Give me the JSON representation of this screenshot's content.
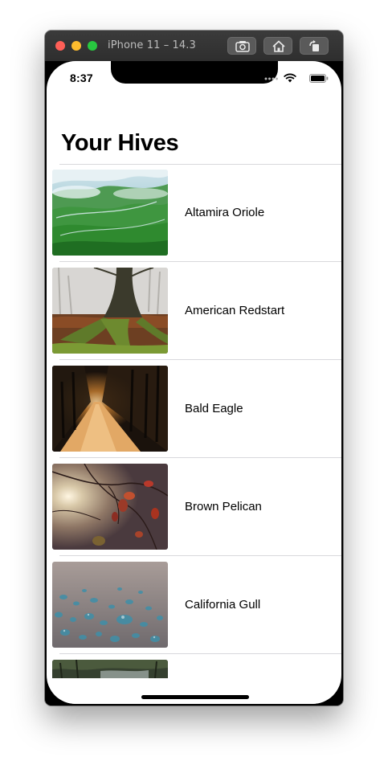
{
  "window": {
    "title": "iPhone 11 – 14.3"
  },
  "status_bar": {
    "time": "8:37"
  },
  "page": {
    "title": "Your Hives"
  },
  "hives": [
    {
      "name": "Altamira Oriole",
      "image": "green-mountain-valley-photo"
    },
    {
      "name": "American Redstart",
      "image": "mossy-tree-forest-photo"
    },
    {
      "name": "Bald Eagle",
      "image": "dark-forest-path-photo"
    },
    {
      "name": "Brown Pelican",
      "image": "autumn-leaves-sun-photo"
    },
    {
      "name": "California Gull",
      "image": "water-droplets-photo"
    },
    {
      "name": "",
      "image": "forest-stream-photo"
    }
  ]
}
